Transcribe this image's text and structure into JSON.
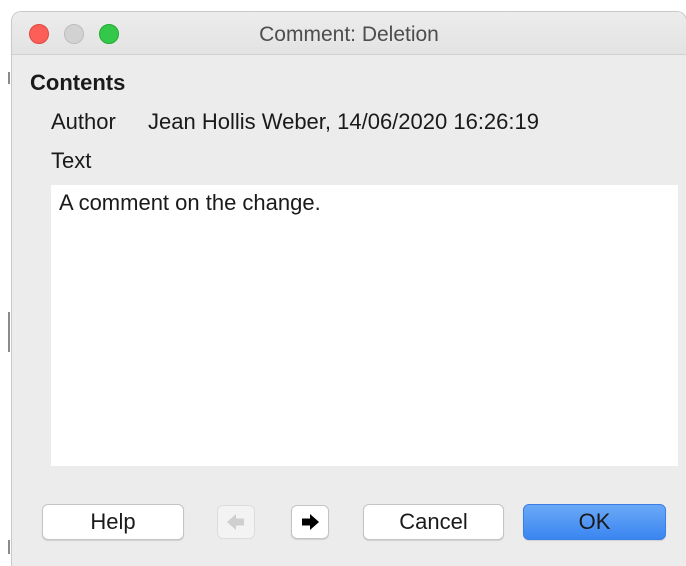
{
  "window": {
    "title": "Comment: Deletion"
  },
  "contents": {
    "heading": "Contents",
    "author_label": "Author",
    "author_value": "Jean Hollis Weber, 14/06/2020 16:26:19",
    "text_label": "Text",
    "comment_text": "A comment on the change."
  },
  "buttons": {
    "help": "Help",
    "cancel": "Cancel",
    "ok": "OK"
  },
  "icons": {
    "previous": "left-arrow-icon",
    "next": "right-arrow-icon"
  },
  "colors": {
    "close_light": "#fc5f57",
    "maximize_light": "#34c84a",
    "ok_button": "#3a85f0"
  }
}
